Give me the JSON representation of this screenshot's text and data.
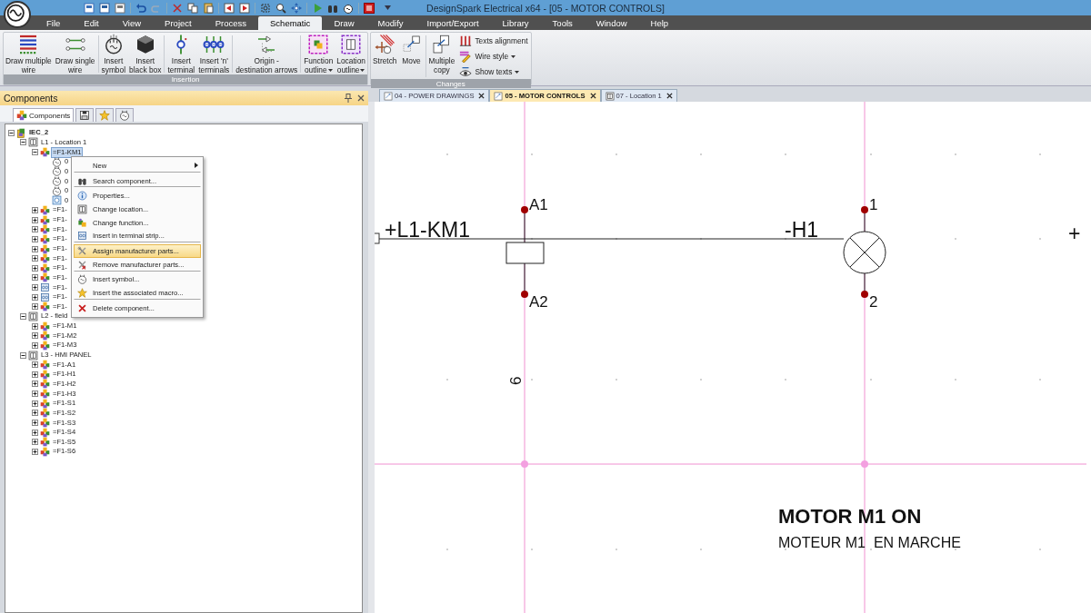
{
  "window": {
    "title": "DesignSpark Electrical x64 - [05 - MOTOR CONTROLS]"
  },
  "menu": [
    {
      "label": "File",
      "selected": false
    },
    {
      "label": "Edit",
      "selected": false
    },
    {
      "label": "View",
      "selected": false
    },
    {
      "label": "Project",
      "selected": false
    },
    {
      "label": "Process",
      "selected": false
    },
    {
      "label": "Schematic",
      "selected": true
    },
    {
      "label": "Draw",
      "selected": false
    },
    {
      "label": "Modify",
      "selected": false
    },
    {
      "label": "Import/Export",
      "selected": false
    },
    {
      "label": "Library",
      "selected": false
    },
    {
      "label": "Tools",
      "selected": false
    },
    {
      "label": "Window",
      "selected": false
    },
    {
      "label": "Help",
      "selected": false
    }
  ],
  "ribbon": [
    {
      "title": "Insertion",
      "buttons": [
        {
          "lines": [
            "Draw multiple",
            "wire"
          ],
          "dropdown": false
        },
        {
          "lines": [
            "Draw single",
            "wire"
          ],
          "dropdown": false
        },
        {
          "lines": [
            "Insert",
            "symbol"
          ],
          "dropdown": false
        },
        {
          "lines": [
            "Insert",
            "black box"
          ],
          "dropdown": false
        },
        {
          "lines": [
            "Insert",
            "terminal"
          ],
          "dropdown": false
        },
        {
          "lines": [
            "Insert 'n'",
            "terminals"
          ],
          "dropdown": false
        },
        {
          "lines": [
            "Origin -",
            "destination arrows"
          ],
          "dropdown": false
        },
        {
          "lines": [
            "Function",
            "outline"
          ],
          "dropdown": true
        },
        {
          "lines": [
            "Location",
            "outline"
          ],
          "dropdown": true
        }
      ]
    },
    {
      "title": "Changes",
      "buttons": [
        {
          "lines": [
            "Stretch"
          ],
          "dropdown": false
        },
        {
          "lines": [
            "Move"
          ],
          "dropdown": false
        },
        {
          "lines": [
            "Multiple",
            "copy"
          ],
          "dropdown": false
        }
      ],
      "small_buttons": [
        {
          "label": "Texts alignment",
          "dropdown": false
        },
        {
          "label": "Wire style",
          "dropdown": true
        },
        {
          "label": "Show texts",
          "dropdown": true
        }
      ]
    }
  ],
  "panel": {
    "title": "Components",
    "tabs": [
      {
        "label": "Components",
        "selected": true
      },
      {
        "selected": false
      },
      {
        "selected": false
      },
      {
        "selected": false
      }
    ]
  },
  "tree": [
    {
      "label": "IEC_2",
      "kind": "project",
      "expanded": true,
      "selected": false,
      "children": [
        {
          "label": "L1 - Location 1",
          "kind": "location",
          "expanded": true,
          "selected": false,
          "children": [
            {
              "label": "=F1-KM1",
              "kind": "component",
              "expanded": true,
              "selected": true,
              "children": [
                {
                  "label": "0",
                  "kind": "symbol",
                  "selected": false
                },
                {
                  "label": "0",
                  "kind": "symbol",
                  "selected": false
                },
                {
                  "label": "0",
                  "kind": "symbol",
                  "selected": false
                },
                {
                  "label": "0",
                  "kind": "symbol",
                  "selected": false
                },
                {
                  "label": "0",
                  "kind": "connector",
                  "selected": false
                }
              ]
            },
            {
              "label": "=F1-",
              "kind": "component",
              "expanded": false,
              "selected": false
            },
            {
              "label": "=F1-",
              "kind": "component",
              "expanded": false,
              "selected": false
            },
            {
              "label": "=F1-",
              "kind": "component",
              "expanded": false,
              "selected": false
            },
            {
              "label": "=F1-",
              "kind": "component",
              "expanded": false,
              "selected": false
            },
            {
              "label": "=F1-",
              "kind": "component",
              "expanded": false,
              "selected": false
            },
            {
              "label": "=F1-",
              "kind": "component",
              "expanded": false,
              "selected": false
            },
            {
              "label": "=F1-",
              "kind": "component",
              "expanded": false,
              "selected": false
            },
            {
              "label": "=F1-",
              "kind": "component",
              "expanded": false,
              "selected": false
            },
            {
              "label": "=F1-",
              "kind": "terminal-strip",
              "expanded": false,
              "selected": false
            },
            {
              "label": "=F1-",
              "kind": "terminal-strip",
              "expanded": false,
              "selected": false
            },
            {
              "label": "=F1-",
              "kind": "component",
              "expanded": false,
              "selected": false
            }
          ]
        },
        {
          "label": "L2 - field",
          "kind": "location",
          "expanded": true,
          "selected": false,
          "children": [
            {
              "label": "=F1-M1",
              "kind": "component",
              "expanded": false,
              "selected": false
            },
            {
              "label": "=F1-M2",
              "kind": "component",
              "expanded": false,
              "selected": false
            },
            {
              "label": "=F1-M3",
              "kind": "component",
              "expanded": false,
              "selected": false
            }
          ]
        },
        {
          "label": "L3 - HMI PANEL",
          "kind": "location",
          "expanded": true,
          "selected": false,
          "children": [
            {
              "label": "=F1-A1",
              "kind": "component",
              "expanded": false,
              "selected": false
            },
            {
              "label": "=F1-H1",
              "kind": "component",
              "expanded": false,
              "selected": false
            },
            {
              "label": "=F1-H2",
              "kind": "component",
              "expanded": false,
              "selected": false
            },
            {
              "label": "=F1-H3",
              "kind": "component",
              "expanded": false,
              "selected": false
            },
            {
              "label": "=F1-S1",
              "kind": "component",
              "expanded": false,
              "selected": false
            },
            {
              "label": "=F1-S2",
              "kind": "component",
              "expanded": false,
              "selected": false
            },
            {
              "label": "=F1-S3",
              "kind": "component",
              "expanded": false,
              "selected": false
            },
            {
              "label": "=F1-S4",
              "kind": "component",
              "expanded": false,
              "selected": false
            },
            {
              "label": "=F1-S5",
              "kind": "component",
              "expanded": false,
              "selected": false
            },
            {
              "label": "=F1-S6",
              "kind": "component",
              "expanded": false,
              "selected": false
            }
          ]
        }
      ]
    }
  ],
  "context_menu": [
    {
      "label": "New",
      "submenu": true,
      "highlighted": false,
      "separator_after": true
    },
    {
      "label": "Search component...",
      "submenu": false,
      "highlighted": false,
      "separator_after": true
    },
    {
      "label": "Properties...",
      "submenu": false,
      "highlighted": false,
      "separator_after": false
    },
    {
      "label": "Change location...",
      "submenu": false,
      "highlighted": false,
      "separator_after": false
    },
    {
      "label": "Change function...",
      "submenu": false,
      "highlighted": false,
      "separator_after": false
    },
    {
      "label": "Insert in terminal strip...",
      "submenu": false,
      "highlighted": false,
      "separator_after": true
    },
    {
      "label": "Assign manufacturer parts...",
      "submenu": false,
      "highlighted": true,
      "separator_after": false
    },
    {
      "label": "Remove manufacturer parts...",
      "submenu": false,
      "highlighted": false,
      "separator_after": true
    },
    {
      "label": "Insert symbol...",
      "submenu": false,
      "highlighted": false,
      "separator_after": false
    },
    {
      "label": "Insert the associated macro...",
      "submenu": false,
      "highlighted": false,
      "separator_after": true
    },
    {
      "label": "Delete component...",
      "submenu": false,
      "highlighted": false,
      "separator_after": false
    }
  ],
  "document_tabs": [
    {
      "label": "04 - POWER DRAWINGS",
      "kind": "drawing",
      "selected": false
    },
    {
      "label": "05 - MOTOR CONTROLS",
      "kind": "drawing",
      "selected": true
    },
    {
      "label": "07 - Location 1",
      "kind": "location",
      "selected": false
    }
  ],
  "schematic": {
    "component_label": "+L1-KM1",
    "coil_pins": [
      "A1",
      "A2"
    ],
    "lamp_tag": "-H1",
    "lamp_pins": [
      "1",
      "2"
    ],
    "wire_end": "+",
    "cross_reference": "6",
    "title": "MOTOR M1 ON",
    "subtitle": "MOTEUR M1  EN MARCHE"
  }
}
